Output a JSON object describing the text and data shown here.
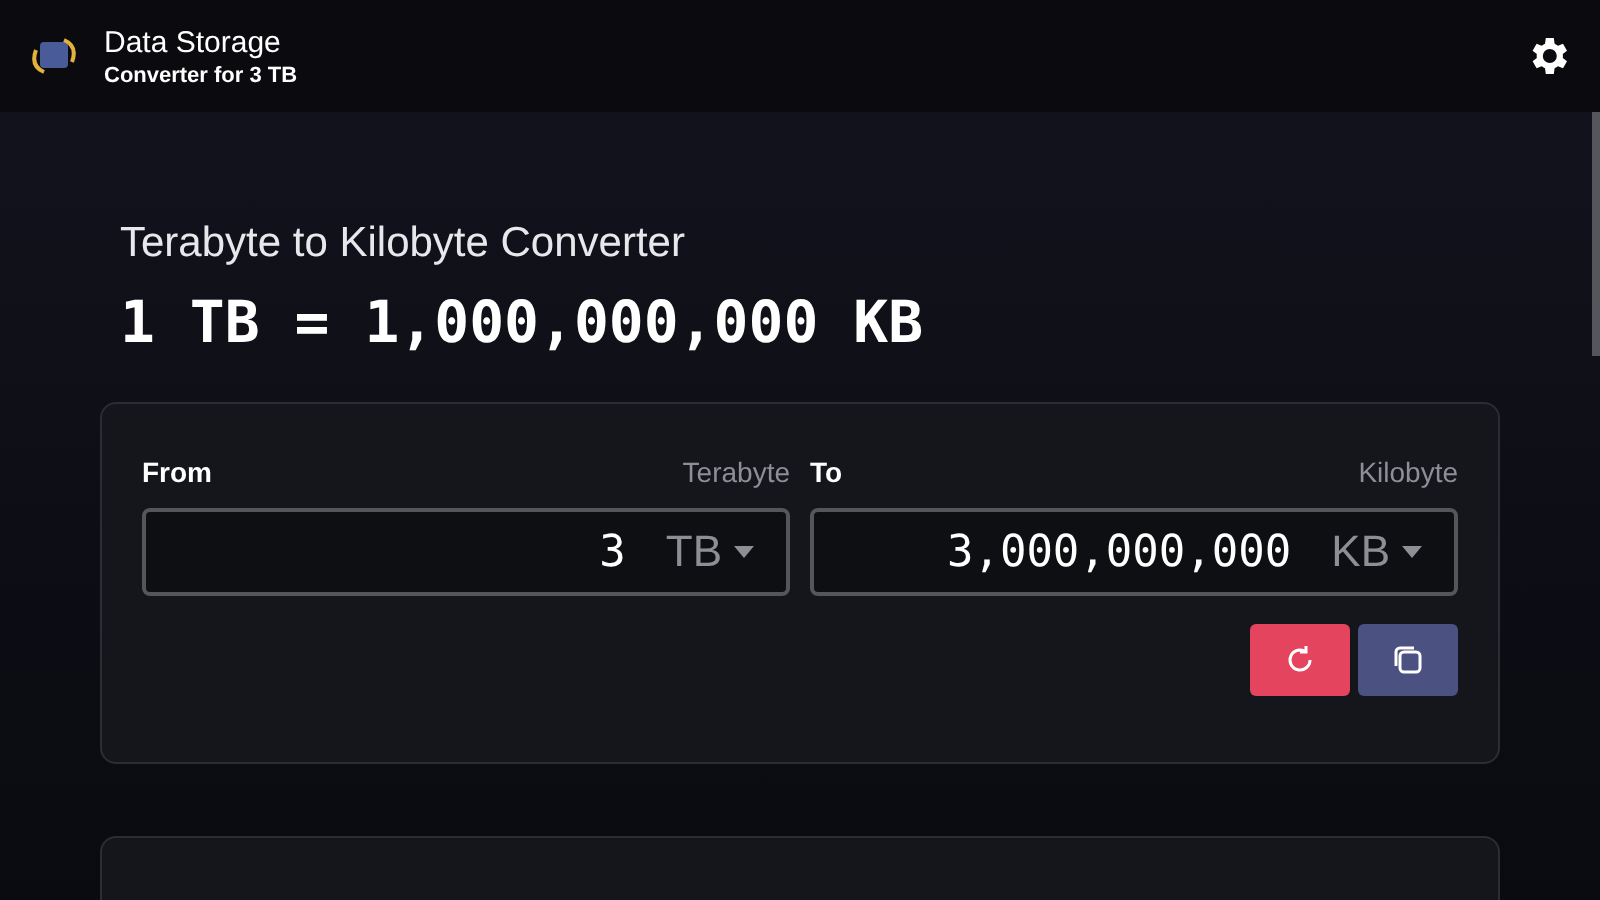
{
  "header": {
    "title": "Data Storage",
    "subtitle": "Converter for 3 TB"
  },
  "heading": "Terabyte to Kilobyte Converter",
  "result": "1 TB = 1,000,000,000 KB",
  "converter": {
    "from": {
      "label": "From",
      "unit_name": "Terabyte",
      "value": "3",
      "unit": "TB"
    },
    "to": {
      "label": "To",
      "unit_name": "Kilobyte",
      "value": "3,000,000,000",
      "unit": "KB"
    }
  }
}
